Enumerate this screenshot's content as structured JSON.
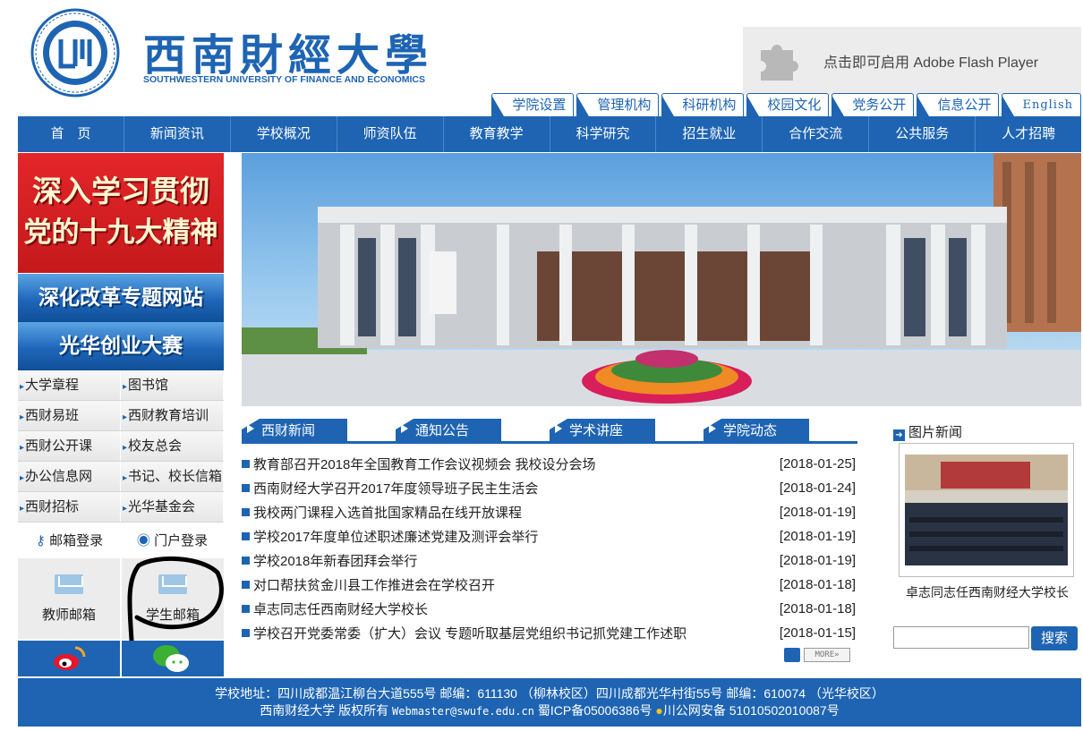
{
  "header": {
    "logo_cn": "西南財經大學",
    "logo_en": "SOUTHWESTERN UNIVERSITY OF FINANCE AND ECONOMICS",
    "flash_text": "点击即可启用 Adobe Flash Player"
  },
  "subtabs": [
    "学院设置",
    "管理机构",
    "科研机构",
    "校园文化",
    "党务公开",
    "信息公开",
    "English"
  ],
  "mainnav": [
    "首　页",
    "新闻资讯",
    "学校概况",
    "师资队伍",
    "教育教学",
    "科学研究",
    "招生就业",
    "合作交流",
    "公共服务",
    "人才招聘"
  ],
  "left": {
    "banner_red_line1": "深入学习贯彻",
    "banner_red_line2": "党的十九大精神",
    "banner_blue1": "深化改革专题网站",
    "banner_blue2": "光华创业大赛",
    "links": [
      [
        "大学章程",
        "图书馆"
      ],
      [
        "西财易班",
        "西财教育培训"
      ],
      [
        "西财公开课",
        "校友总会"
      ],
      [
        "办公信息网",
        "书记、校长信箱"
      ],
      [
        "西财招标",
        "光华基金会"
      ]
    ],
    "login_mail": "邮箱登录",
    "login_portal": "门户登录",
    "teacher_mail": "教师邮箱",
    "student_mail": "学生邮箱"
  },
  "news": {
    "tabs": [
      "西财新闻",
      "通知公告",
      "学术讲座",
      "学院动态"
    ],
    "items": [
      {
        "title": "教育部召开2018年全国教育工作会议视频会 我校设分会场",
        "date": "[2018-01-25]"
      },
      {
        "title": "西南财经大学召开2017年度领导班子民主生活会",
        "date": "[2018-01-24]"
      },
      {
        "title": "我校两门课程入选首批国家精品在线开放课程",
        "date": "[2018-01-19]"
      },
      {
        "title": "学校2017年度单位述职述廉述党建及测评会举行",
        "date": "[2018-01-19]"
      },
      {
        "title": "学校2018年新春团拜会举行",
        "date": "[2018-01-19]"
      },
      {
        "title": "对口帮扶贫金川县工作推进会在学校召开",
        "date": "[2018-01-18]"
      },
      {
        "title": "卓志同志任西南财经大学校长",
        "date": "[2018-01-18]"
      },
      {
        "title": "学校召开党委常委（扩大）会议 专题听取基层党组织书记抓党建工作述职",
        "date": "[2018-01-15]"
      }
    ],
    "more": "MORE»"
  },
  "right": {
    "pic_title": "图片新闻",
    "pic_caption": "卓志同志任西南财经大学校长",
    "search_value": "",
    "search_button": "搜索"
  },
  "footer": {
    "line1": "学校地址：四川成都温江柳台大道555号 邮编：611130 （柳林校区）四川成都光华村街55号 邮编：610074 （光华校区）",
    "line2_a": "西南财经大学 版权所有 ",
    "line2_email": "Webmaster@swufe.edu.cn",
    "line2_b": " 蜀ICP备05006386号 ",
    "line2_c": "川公网安备 51010502010087号"
  },
  "colors": {
    "brand": "#1e64b3",
    "banner_red": "#e3262a"
  }
}
